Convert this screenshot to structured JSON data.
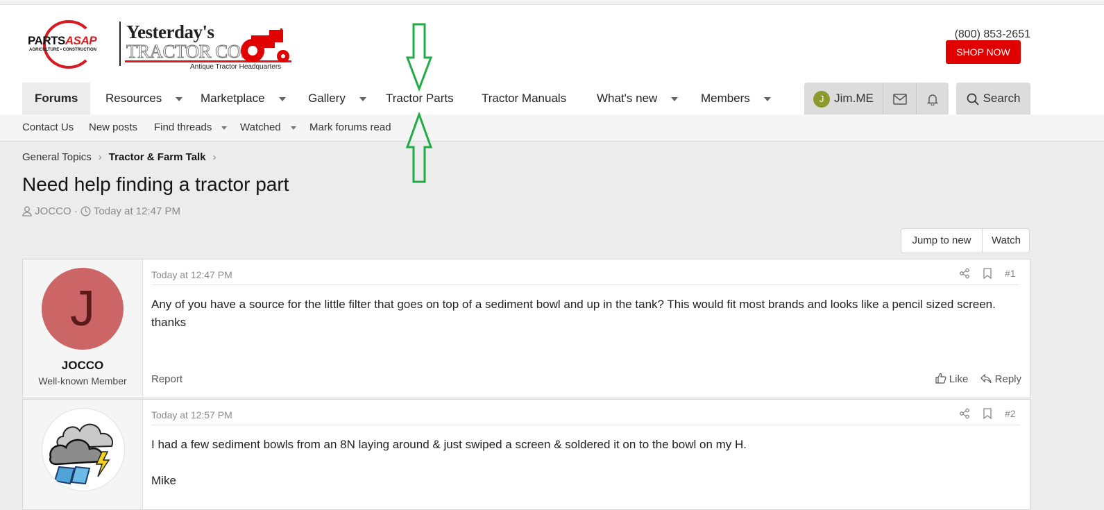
{
  "logo": {
    "parts": "PARTS",
    "asap": "ASAP",
    "parts_sub": "AGRICULTURE • CONSTRUCTION",
    "name_line1": "Yesterday's",
    "name_line2": "TRACTOR CO.",
    "tagline": "Antique Tractor Headquarters"
  },
  "header": {
    "phone": "(800) 853-2651",
    "shop_now": "SHOP NOW"
  },
  "nav": {
    "items": [
      {
        "label": "Forums"
      },
      {
        "label": "Resources"
      },
      {
        "label": "Marketplace"
      },
      {
        "label": "Gallery"
      },
      {
        "label": "Tractor Parts"
      },
      {
        "label": "Tractor Manuals"
      },
      {
        "label": "What's new"
      },
      {
        "label": "Members"
      }
    ],
    "user_initial": "J",
    "user_name": "Jim.ME",
    "search": "Search"
  },
  "subnav": {
    "items": [
      "Contact Us",
      "New posts",
      "Find threads",
      "Watched",
      "Mark forums read"
    ]
  },
  "breadcrumb": [
    "General Topics",
    "Tractor & Farm Talk"
  ],
  "thread": {
    "title": "Need help finding a tractor part",
    "author": "JOCCO",
    "time": "Today at 12:47 PM",
    "jump_to_new": "Jump to new",
    "watch": "Watch"
  },
  "posts": [
    {
      "date": "Today at 12:47 PM",
      "number": "#1",
      "avatar_letter": "J",
      "username": "JOCCO",
      "user_title": "Well-known Member",
      "body": "Any of you have a source for the little filter that goes on top of a sediment bowl and up in the tank? This would fit most brands and looks like a pencil sized screen. thanks",
      "report": "Report",
      "like": "Like",
      "reply": "Reply"
    },
    {
      "date": "Today at 12:57 PM",
      "number": "#2",
      "body_line1": "I had a few sediment bowls from an 8N laying around & just swiped a screen & soldered it on to the bowl on my H.",
      "body_line2": "Mike"
    }
  ],
  "colors": {
    "accent_red": "#e00000",
    "annotation_green": "#22aa44",
    "avatar_red": "#cc6666"
  }
}
